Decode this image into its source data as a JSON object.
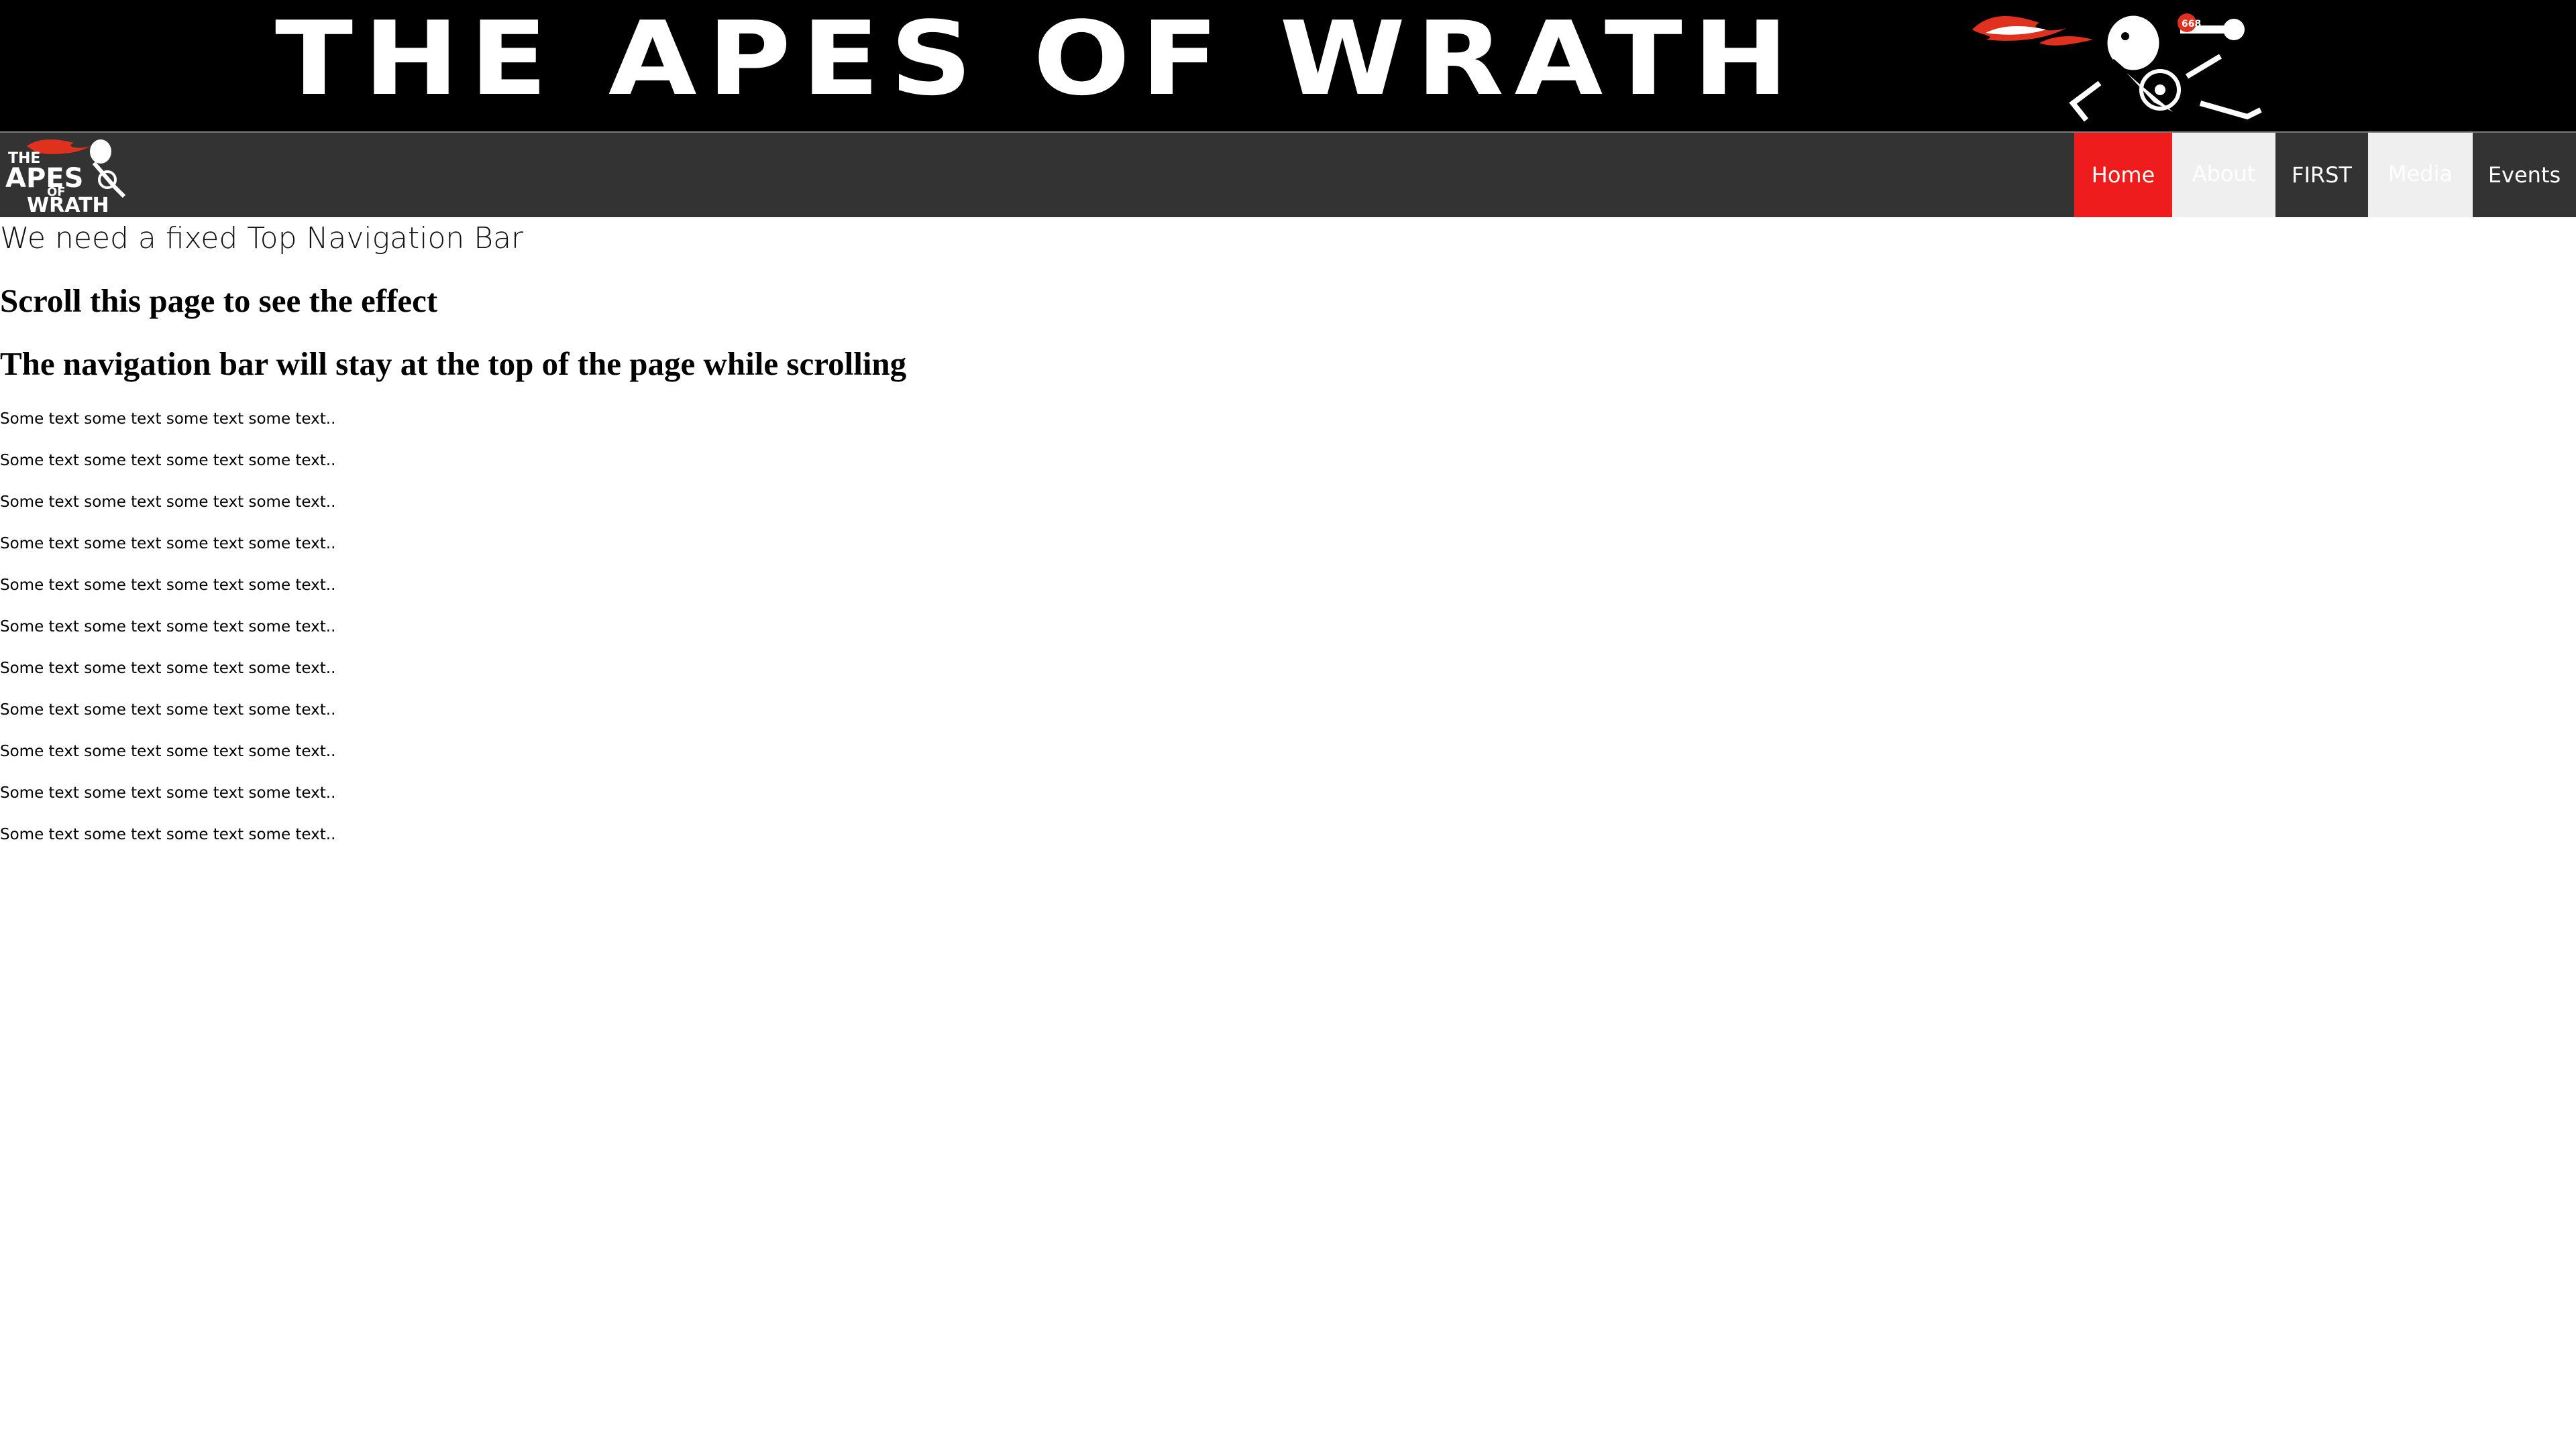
{
  "banner": {
    "title": "THE APES OF WRATH",
    "mascot_badge": "668"
  },
  "navbar": {
    "logo": {
      "line1": "THE",
      "line2": "APES",
      "line3": "OF",
      "line4": "WRATH"
    },
    "items": [
      {
        "label": "Home",
        "state": "active"
      },
      {
        "label": "About",
        "state": "hover"
      },
      {
        "label": "FIRST",
        "state": "normal"
      },
      {
        "label": "Media",
        "state": "hover"
      },
      {
        "label": "Events",
        "state": "normal"
      }
    ]
  },
  "content": {
    "intro": "We need a fixed Top Navigation Bar",
    "heading1": "Scroll this page to see the effect",
    "heading2": "The navigation bar will stay at the top of the page while scrolling",
    "paragraphs": [
      "Some text some text some text some text..",
      "Some text some text some text some text..",
      "Some text some text some text some text..",
      "Some text some text some text some text..",
      "Some text some text some text some text..",
      "Some text some text some text some text..",
      "Some text some text some text some text..",
      "Some text some text some text some text..",
      "Some text some text some text some text..",
      "Some text some text some text some text..",
      "Some text some text some text some text.."
    ]
  },
  "colors": {
    "banner_bg": "#000000",
    "navbar_bg": "#333333",
    "active_tab": "#ee1c1c",
    "hover_tab": "#efefef",
    "flame_red": "#e0301e"
  }
}
